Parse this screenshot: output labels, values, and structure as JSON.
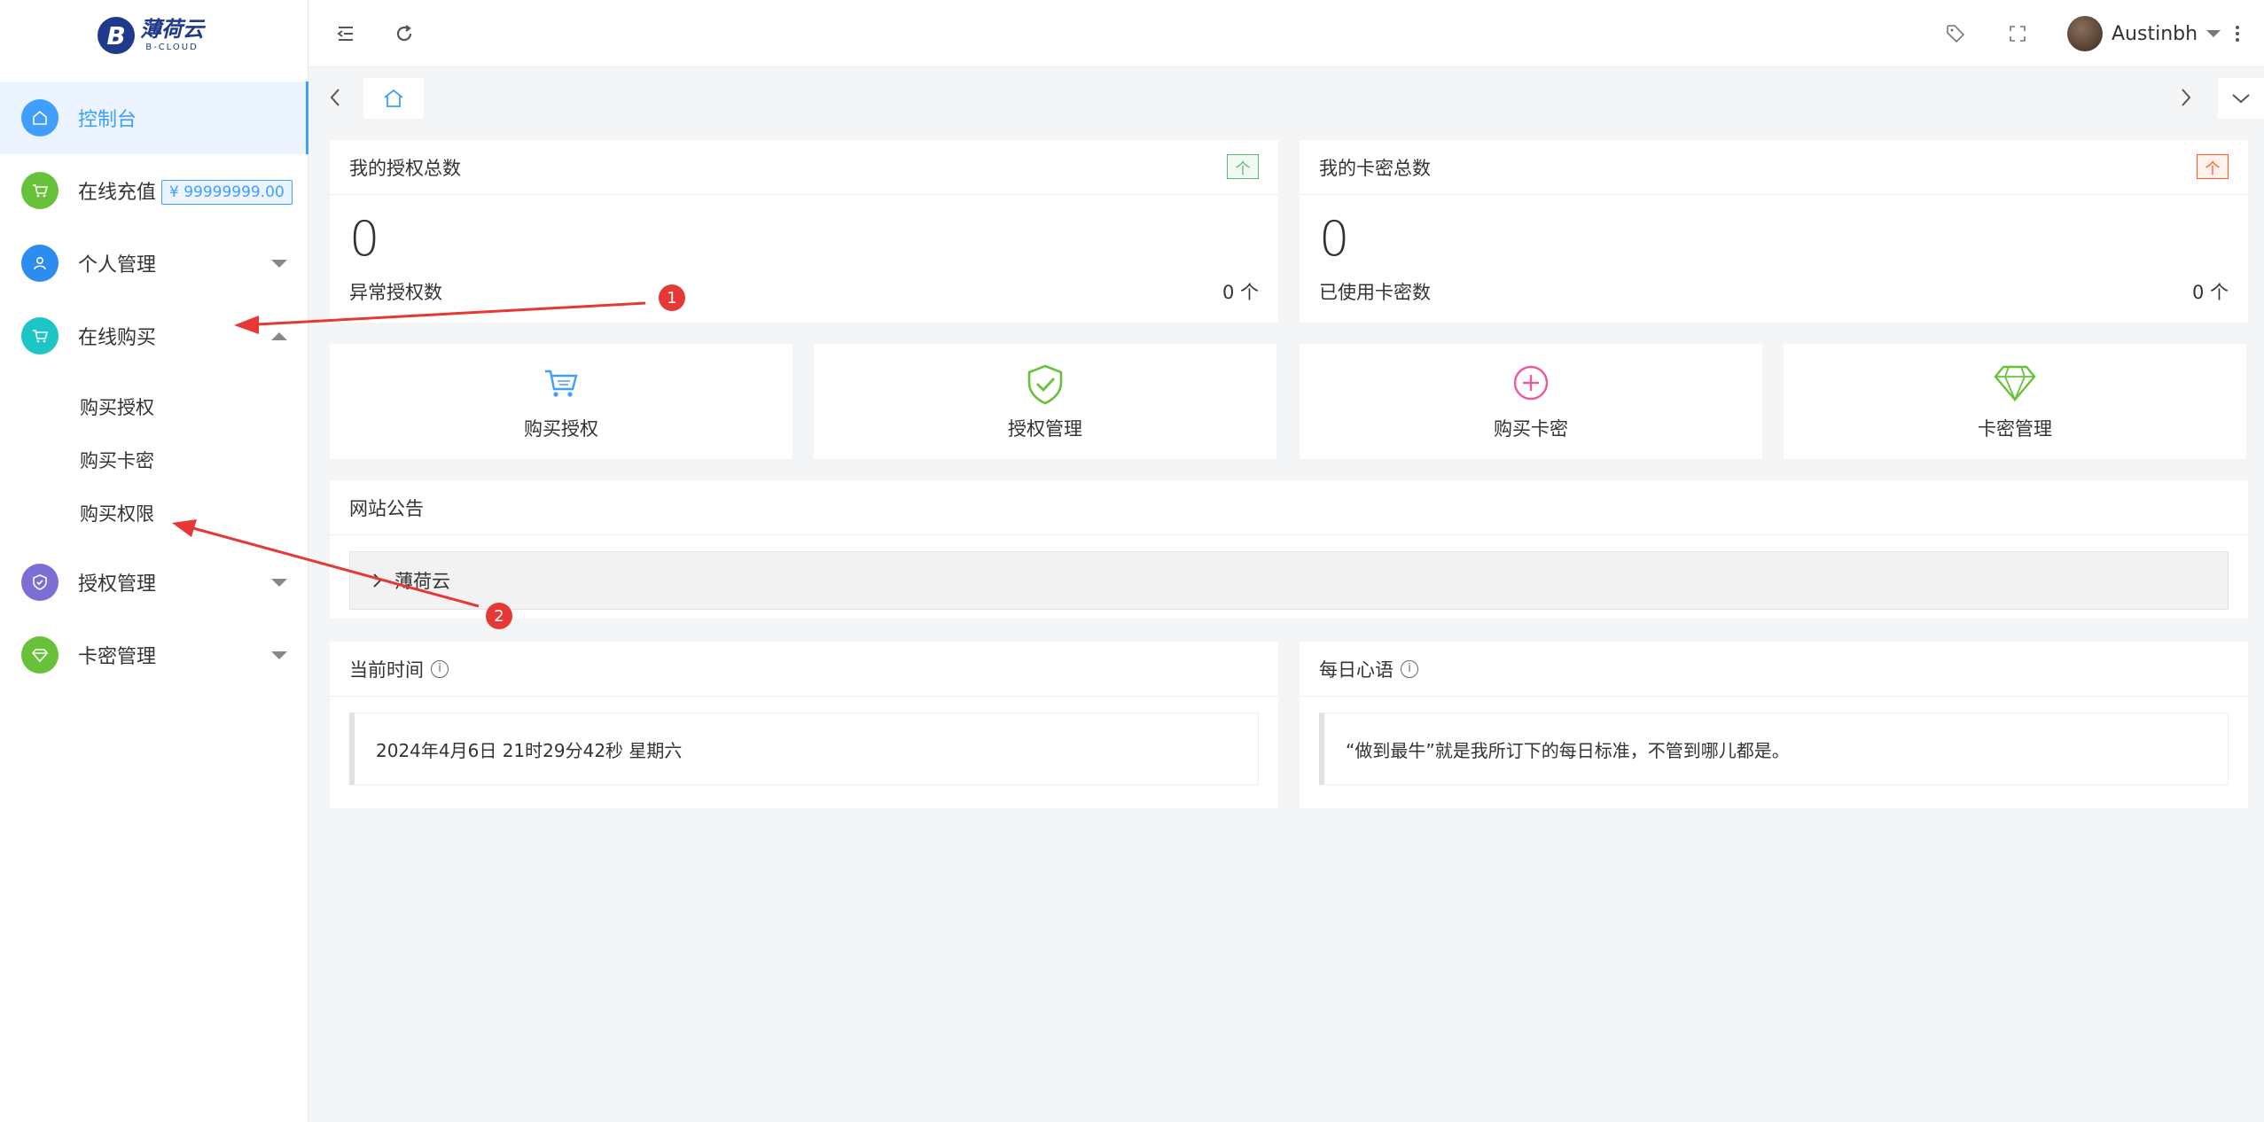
{
  "brand": {
    "name_cn": "薄荷云",
    "name_en": "B-CLOUD",
    "logo_letter": "B",
    "color": "#1f3a8a"
  },
  "sidebar": {
    "items": [
      {
        "label": "控制台",
        "icon": "home-icon",
        "color": "#409eff",
        "active": true
      },
      {
        "label": "在线充值",
        "icon": "cart-icon",
        "color": "#67c23a",
        "balance": "¥ 99999999.00"
      },
      {
        "label": "个人管理",
        "icon": "user-icon",
        "color": "#2d8cf0"
      },
      {
        "label": "在线购买",
        "icon": "cart-icon",
        "color": "#1ec5c5",
        "expanded": true,
        "children": [
          {
            "label": "购买授权"
          },
          {
            "label": "购买卡密"
          },
          {
            "label": "购买权限"
          }
        ]
      },
      {
        "label": "授权管理",
        "icon": "shield-icon",
        "color": "#7b6fd6"
      },
      {
        "label": "卡密管理",
        "icon": "diamond-icon",
        "color": "#67c23a"
      }
    ]
  },
  "topbar": {
    "username": "Austinbh"
  },
  "stats": [
    {
      "title": "我的授权总数",
      "badge": "个",
      "badge_color": "green",
      "value": "0",
      "sub_label": "异常授权数",
      "sub_value": "0 个"
    },
    {
      "title": "我的卡密总数",
      "badge": "个",
      "badge_color": "red",
      "value": "0",
      "sub_label": "已使用卡密数",
      "sub_value": "0 个"
    }
  ],
  "quick_links": [
    {
      "label": "购买授权",
      "icon": "cart-icon",
      "color": "#409eff"
    },
    {
      "label": "授权管理",
      "icon": "shield-check-icon",
      "color": "#67c23a"
    },
    {
      "label": "购买卡密",
      "icon": "plus-circle-icon",
      "color": "#e85aa4"
    },
    {
      "label": "卡密管理",
      "icon": "diamond-icon",
      "color": "#67c23a"
    }
  ],
  "notice": {
    "title": "网站公告",
    "items": [
      "薄荷云"
    ]
  },
  "time_panel": {
    "title": "当前时间",
    "value": "2024年4月6日 21时29分42秒 星期六"
  },
  "quote_panel": {
    "title": "每日心语",
    "value": "“做到最牛”就是我所订下的每日标准，不管到哪儿都是。"
  },
  "annotations": [
    {
      "label": "1"
    },
    {
      "label": "2"
    }
  ]
}
